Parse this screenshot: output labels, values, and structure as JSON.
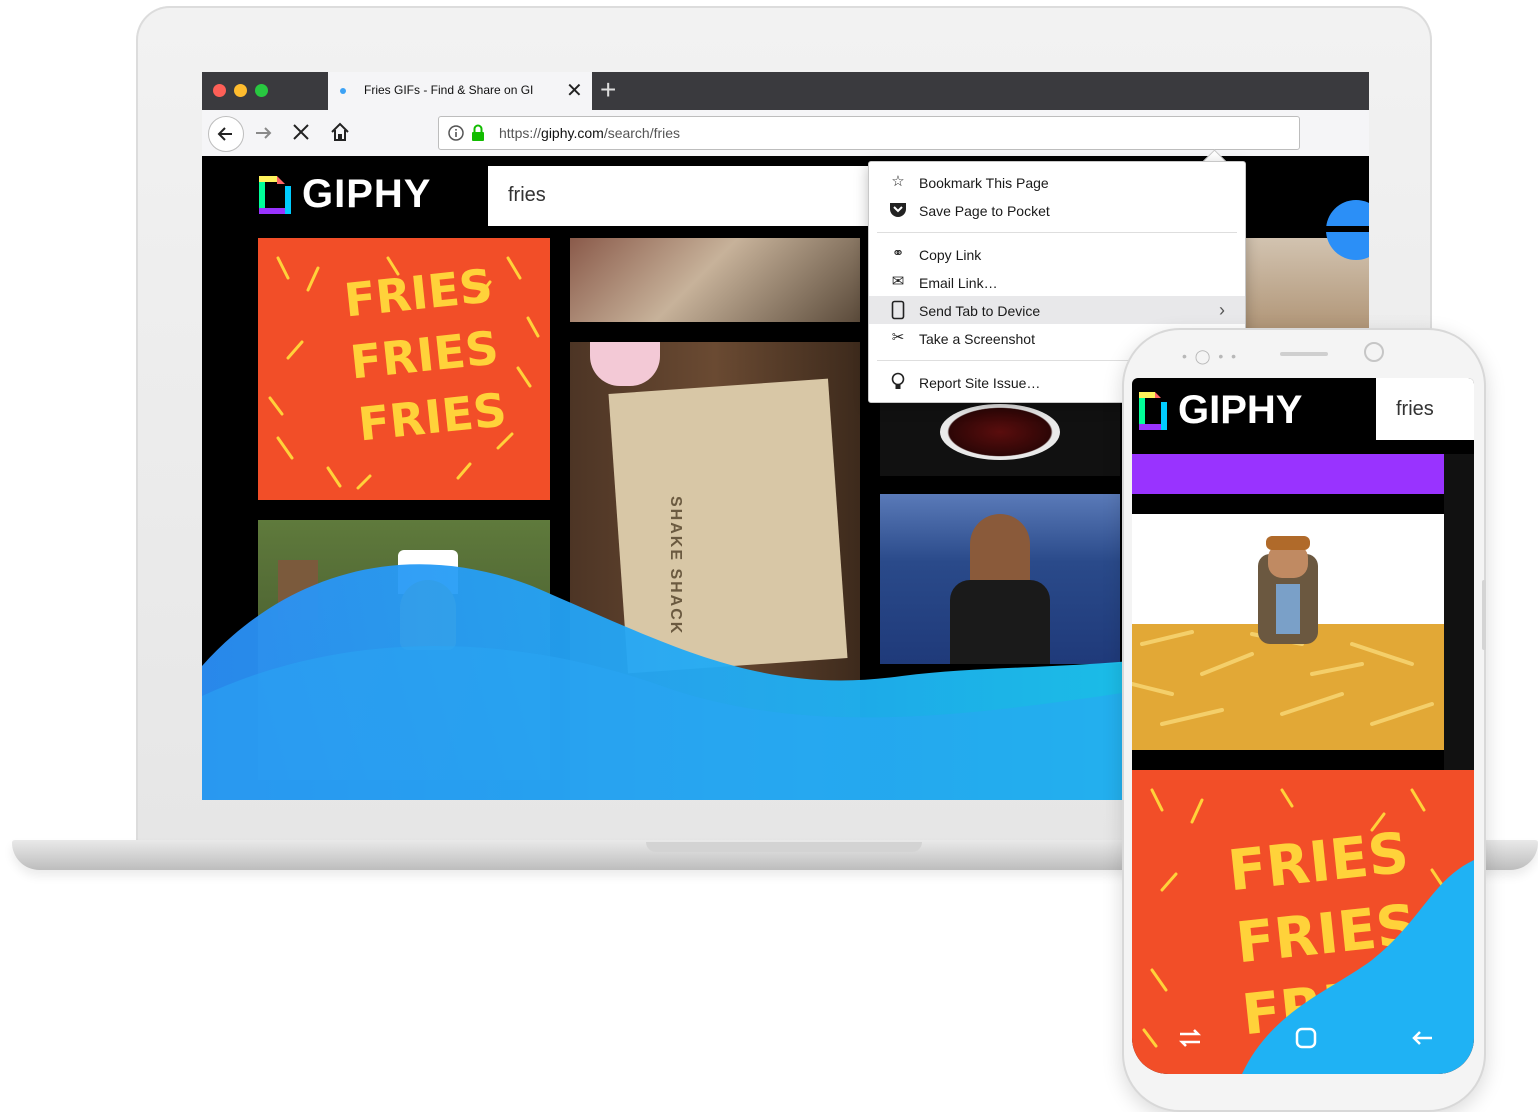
{
  "browser": {
    "tab": {
      "title": "Fries GIFs - Find & Share on GI",
      "close": "✕"
    },
    "new_tab": "+",
    "url": {
      "prefix": "https://",
      "domain": "giphy.com",
      "path": "/search/fries"
    },
    "page_actions_label": "···"
  },
  "giphy": {
    "logo": "GIPHY",
    "search_value": "fries",
    "fries_tile": {
      "line1": "FRIES",
      "line2": "FRIES",
      "line3": "FRIES"
    },
    "shake_shack": "SHAKE SHACK"
  },
  "menu": {
    "items": [
      {
        "label": "Bookmark This Page",
        "icon": "star-icon"
      },
      {
        "label": "Save Page to Pocket",
        "icon": "pocket-icon"
      },
      {
        "label": "Copy Link",
        "icon": "link-icon"
      },
      {
        "label": "Email Link…",
        "icon": "mail-icon"
      },
      {
        "label": "Send Tab to Device",
        "icon": "device-icon"
      },
      {
        "label": "Take a Screenshot",
        "icon": "scissors-icon"
      },
      {
        "label": "Report Site Issue…",
        "icon": "lightbulb-icon"
      }
    ],
    "submenu_arrow": "›"
  },
  "phone": {
    "logo": "GIPHY",
    "search_value": "fries",
    "fries_tile": {
      "line1": "FRIES",
      "line2": "FRIES",
      "line3": "FRIES"
    }
  },
  "colors": {
    "tab_strip": "#3a3a3e",
    "giphy_purple": "#9933ff",
    "fries_red": "#f24e28",
    "fries_yellow": "#ffd23a",
    "wave_blue": "#2b8ff7",
    "wave_cyan": "#1ad8f2"
  }
}
